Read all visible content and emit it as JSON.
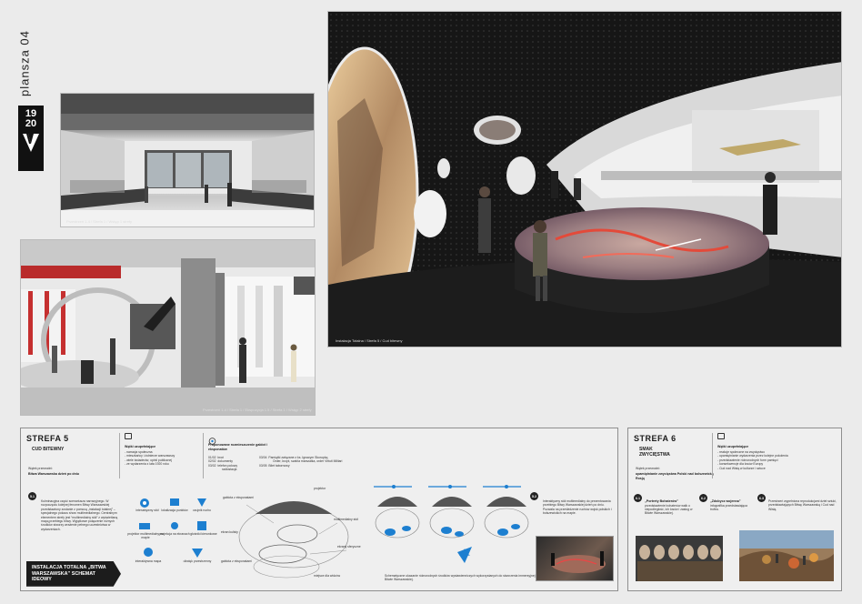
{
  "side": {
    "plansza": "plansza 04",
    "logo_top": "19",
    "logo_bottom": "20"
  },
  "photos": {
    "top_left_caption": "Przestrzeń 1.4 / Strefa 1 / Wstęp 1 strefy",
    "mid_left_caption": "Przestrzeń 1.4 / Strefa 1 / Ekspozycja 1.5 / Strefa 1 / Wstęp 2 strefy",
    "main_caption": "Instalacja Totalna / Strefa 5 / Cud bitewny"
  },
  "strefa5": {
    "title": "STREFA 5",
    "subtitle": "CUD BITEWNY",
    "lead_label": "Wątek przewodni:",
    "lead_text": "Bitwa Warszawska dzień po dniu",
    "col1_title": "Wątki uzupełniające",
    "col1_items": [
      "- narracja społeczna",
      "- mieszkańcy i żołnierze warszawscy",
      "- wiele świadectw, opinii publicznej",
      "- ze wydarzenia z lata 1920 roku"
    ],
    "col2_title": "Proponowane rozmieszczenie gablot i eksponatów",
    "col2_rows": [
      [
        "01/02",
        "broń"
      ],
      [
        "02/02",
        "dokumenty"
      ],
      [
        "03/02",
        "telefon polowy"
      ],
      [
        "",
        "radiostacja"
      ],
      [
        "03/04",
        "Pamiątki związane z ks. Ignacym Skorupką"
      ],
      [
        "",
        "Order, krzyż, szabla marszałka, order Virtuti Militari"
      ],
      [
        "03/05",
        "Bilet tabornowy"
      ]
    ],
    "para": "Kulminacyjna część scenariusza narracyjnego. W rozpoczęciu kolejnej fenomen Bitwy Warszawskiej przedstawiony zostanie z pomocą „instalacji totalnej” – specjalnego pokazu show multimedialnego. Centralnym elementem strefy jest “multimedialny stół” z wyświetlaną mapą przebiegu bitwy. Wyjątkowe połączenie różnych środków stworzy wrażenie pełnego uczestnictwa w wydarzeniach.",
    "icons": [
      "interaktywny stół",
      "lokalizacja punktów",
      "projektor multimedialny na mapie",
      "projekcja na ekranach",
      "głośniki kierunkowe",
      "czujnik ruchu",
      "interaktywna mapa",
      "dźwięk przestrzenny"
    ],
    "install_btn": "INSTALACJA TOTALNA „BITWA WARSZAWSKA” SCHEMAT IDEOWY",
    "diagram_labels": [
      "gablota z eksponatami",
      "projektor",
      "multimedialny stół",
      "ekran kulisty",
      "ekrany sferyczne",
      "gablota z eksponatami",
      "miejsce dla widzów"
    ],
    "bottom_text": "Schematyczne ukazanie różnorodnych środków wystawienniczych wykorzystanych do stworzenia immersyjnej opowieści o Bitwie Warszawskiej.",
    "right_text": "Interaktywny stół multimedialny do prezentowania przebiegu Bitwy Warszawskiej dzień po dniu. Pozwala na prześledzenie ruchów wojsk polskich i bolszewickich na mapie."
  },
  "strefa6": {
    "title": "STREFA 6",
    "subtitle": "SMAK ZWYCIĘSTWA",
    "lead_label": "Wątek przewodni:",
    "lead_text": "upamiętnianie zwycięstwa Polski nad bolszewicką Rosją",
    "col1_title": "Wątki uzupełniające",
    "col1_items": [
      "- reakcje społeczne na zwycięstwo",
      "- upamiętnianie wydarzenia przez kolejne pokolenia",
      "- przedstawienie różnorodnych form pamięci",
      "- konsekwencje dla losów Europy",
      "- Cud nad Wisłą w kulturze i sztuce"
    ],
    "item1_title": "„Portrety Bohaterów”",
    "item1_text": "przedstawienie bohaterów walk o niepodległość, ich losów i zasług w Bitwie Warszawskiej.",
    "item2_title": "„Zdobycz wojenna”",
    "item2_text": "infografika przedstawiająca trofea.",
    "item3_text": "Przestrzeń wypełniona reprodukcjami dzieł sztuki, przedstawiających Bitwę Warszawską i Cud nad Wisłą."
  },
  "colors": {
    "panel_border": "#8e8e8e",
    "accent_blue": "#1d7fd0",
    "dark": "#1c1c1c"
  }
}
